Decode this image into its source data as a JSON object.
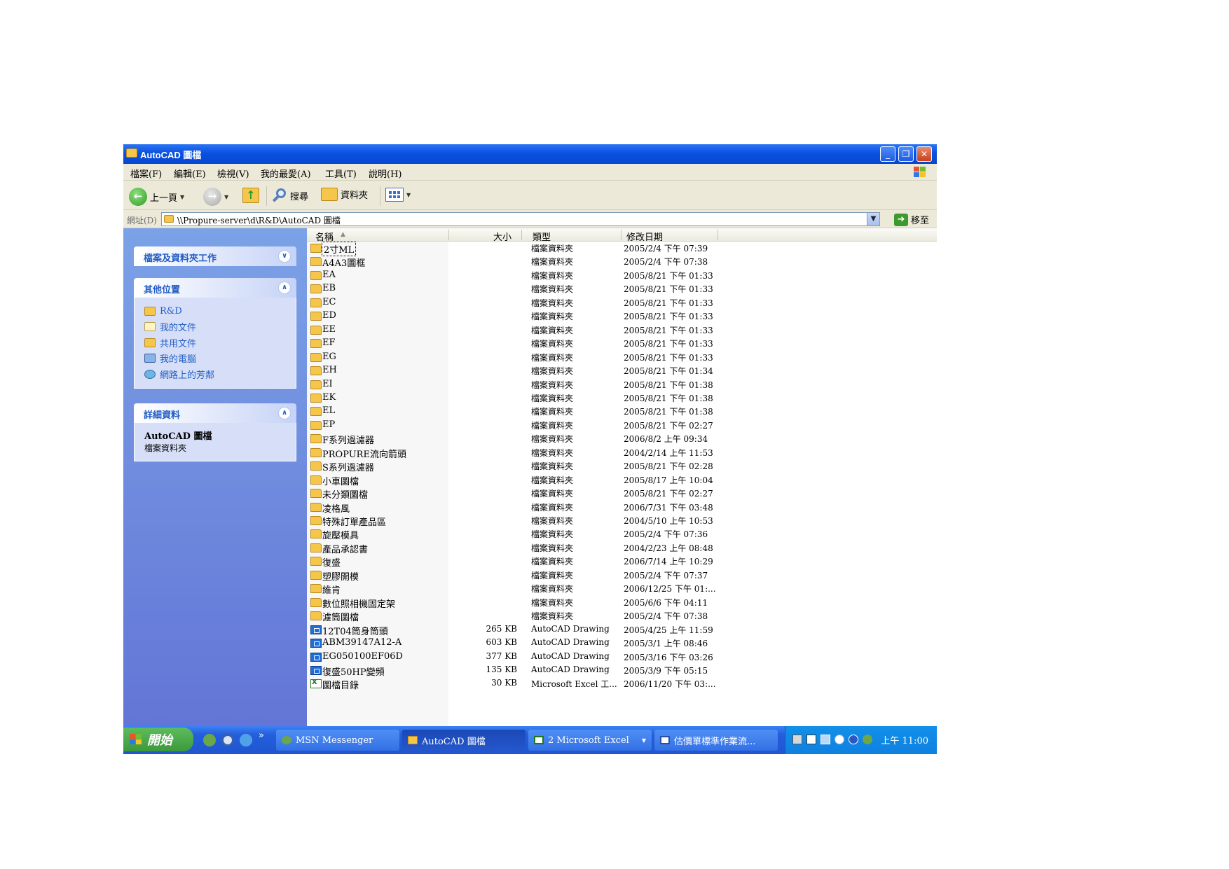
{
  "window": {
    "title": "AutoCAD 圖檔",
    "buttons": {
      "minimize": "_",
      "restore": "❐",
      "close": "✕"
    }
  },
  "menu": [
    "檔案(F)",
    "編輯(E)",
    "檢視(V)",
    "我的最愛(A)",
    "工具(T)",
    "說明(H)"
  ],
  "toolbar": {
    "back_label": "上一頁",
    "search_label": "搜尋",
    "folders_label": "資料夾"
  },
  "address": {
    "label": "網址(D)",
    "path": "\\\\Propure-server\\d\\R&D\\AutoCAD 圖檔",
    "go_label": "移至"
  },
  "sidebar": {
    "file_tasks_title": "檔案及資料夾工作",
    "other_places_title": "其他位置",
    "other_places": [
      {
        "label": "R&D",
        "icon": "folder-icon"
      },
      {
        "label": "我的文件",
        "icon": "my-documents-icon"
      },
      {
        "label": "共用文件",
        "icon": "folder-icon"
      },
      {
        "label": "我的電腦",
        "icon": "my-computer-icon"
      },
      {
        "label": "網路上的芳鄰",
        "icon": "network-places-icon"
      }
    ],
    "details_title": "詳細資料",
    "details_name": "AutoCAD 圖檔",
    "details_type": "檔案資料夾"
  },
  "columns": {
    "name": "名稱",
    "size": "大小",
    "type": "類型",
    "modified": "修改日期"
  },
  "files": [
    {
      "name": "2寸ML",
      "size": "",
      "type": "檔案資料夾",
      "modified": "2005/2/4 下午 07:39",
      "icon": "folder"
    },
    {
      "name": "A4A3圖框",
      "size": "",
      "type": "檔案資料夾",
      "modified": "2005/2/4 下午 07:38",
      "icon": "folder"
    },
    {
      "name": "EA",
      "size": "",
      "type": "檔案資料夾",
      "modified": "2005/8/21 下午 01:33",
      "icon": "folder"
    },
    {
      "name": "EB",
      "size": "",
      "type": "檔案資料夾",
      "modified": "2005/8/21 下午 01:33",
      "icon": "folder"
    },
    {
      "name": "EC",
      "size": "",
      "type": "檔案資料夾",
      "modified": "2005/8/21 下午 01:33",
      "icon": "folder"
    },
    {
      "name": "ED",
      "size": "",
      "type": "檔案資料夾",
      "modified": "2005/8/21 下午 01:33",
      "icon": "folder"
    },
    {
      "name": "EE",
      "size": "",
      "type": "檔案資料夾",
      "modified": "2005/8/21 下午 01:33",
      "icon": "folder"
    },
    {
      "name": "EF",
      "size": "",
      "type": "檔案資料夾",
      "modified": "2005/8/21 下午 01:33",
      "icon": "folder"
    },
    {
      "name": "EG",
      "size": "",
      "type": "檔案資料夾",
      "modified": "2005/8/21 下午 01:33",
      "icon": "folder"
    },
    {
      "name": "EH",
      "size": "",
      "type": "檔案資料夾",
      "modified": "2005/8/21 下午 01:34",
      "icon": "folder"
    },
    {
      "name": "EI",
      "size": "",
      "type": "檔案資料夾",
      "modified": "2005/8/21 下午 01:38",
      "icon": "folder"
    },
    {
      "name": "EK",
      "size": "",
      "type": "檔案資料夾",
      "modified": "2005/8/21 下午 01:38",
      "icon": "folder"
    },
    {
      "name": "EL",
      "size": "",
      "type": "檔案資料夾",
      "modified": "2005/8/21 下午 01:38",
      "icon": "folder"
    },
    {
      "name": "EP",
      "size": "",
      "type": "檔案資料夾",
      "modified": "2005/8/21 下午 02:27",
      "icon": "folder"
    },
    {
      "name": "F系列過濾器",
      "size": "",
      "type": "檔案資料夾",
      "modified": "2006/8/2 上午 09:34",
      "icon": "folder"
    },
    {
      "name": "PROPURE流向箭頭",
      "size": "",
      "type": "檔案資料夾",
      "modified": "2004/2/14 上午 11:53",
      "icon": "folder"
    },
    {
      "name": "S系列過濾器",
      "size": "",
      "type": "檔案資料夾",
      "modified": "2005/8/21 下午 02:28",
      "icon": "folder"
    },
    {
      "name": "小車圖檔",
      "size": "",
      "type": "檔案資料夾",
      "modified": "2005/8/17 上午 10:04",
      "icon": "folder"
    },
    {
      "name": "未分類圖檔",
      "size": "",
      "type": "檔案資料夾",
      "modified": "2005/8/21 下午 02:27",
      "icon": "folder"
    },
    {
      "name": "凌格風",
      "size": "",
      "type": "檔案資料夾",
      "modified": "2006/7/31 下午 03:48",
      "icon": "folder"
    },
    {
      "name": "特殊訂單產品區",
      "size": "",
      "type": "檔案資料夾",
      "modified": "2004/5/10 上午 10:53",
      "icon": "folder"
    },
    {
      "name": "旋壓模具",
      "size": "",
      "type": "檔案資料夾",
      "modified": "2005/2/4 下午 07:36",
      "icon": "folder"
    },
    {
      "name": "產品承認書",
      "size": "",
      "type": "檔案資料夾",
      "modified": "2004/2/23 上午 08:48",
      "icon": "folder"
    },
    {
      "name": "復盛",
      "size": "",
      "type": "檔案資料夾",
      "modified": "2006/7/14 上午 10:29",
      "icon": "folder"
    },
    {
      "name": "塑膠開模",
      "size": "",
      "type": "檔案資料夾",
      "modified": "2005/2/4 下午 07:37",
      "icon": "folder"
    },
    {
      "name": "維肯",
      "size": "",
      "type": "檔案資料夾",
      "modified": "2006/12/25 下午 01:...",
      "icon": "folder"
    },
    {
      "name": "數位照相機固定架",
      "size": "",
      "type": "檔案資料夾",
      "modified": "2005/6/6 下午 04:11",
      "icon": "folder"
    },
    {
      "name": "濾筒圖檔",
      "size": "",
      "type": "檔案資料夾",
      "modified": "2005/2/4 下午 07:38",
      "icon": "folder"
    },
    {
      "name": "12T04筒身筒頭",
      "size": "265 KB",
      "type": "AutoCAD Drawing",
      "modified": "2005/4/25 上午 11:59",
      "icon": "dwg"
    },
    {
      "name": "ABM39147A12-A",
      "size": "603 KB",
      "type": "AutoCAD Drawing",
      "modified": "2005/3/1 上午 08:46",
      "icon": "dwg"
    },
    {
      "name": "EG050100EF06D",
      "size": "377 KB",
      "type": "AutoCAD Drawing",
      "modified": "2005/3/16 下午 03:26",
      "icon": "dwg"
    },
    {
      "name": "復盛50HP變頻",
      "size": "135 KB",
      "type": "AutoCAD Drawing",
      "modified": "2005/3/9 下午 05:15",
      "icon": "dwg"
    },
    {
      "name": "圖檔目錄",
      "size": "30 KB",
      "type": "Microsoft Excel 工...",
      "modified": "2006/11/20 下午 03:...",
      "icon": "xls"
    }
  ],
  "taskbar": {
    "start_label": "開始",
    "more": "»",
    "tasks": [
      {
        "label": "MSN Messenger",
        "active": false
      },
      {
        "label": "AutoCAD 圖檔",
        "active": true
      },
      {
        "label": "2 Microsoft Excel",
        "active": false
      },
      {
        "label": "估價單標準作業流...",
        "active": false
      }
    ],
    "clock": "上午 11:00"
  }
}
